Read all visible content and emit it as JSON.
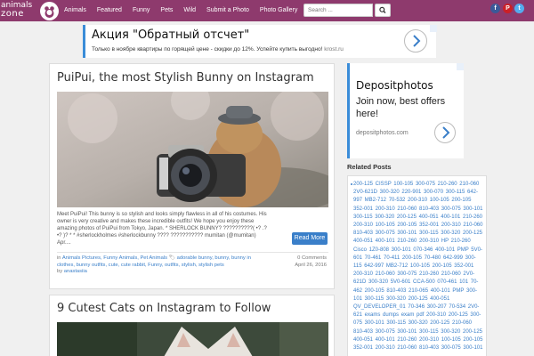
{
  "brand": {
    "logo_line1": "animals",
    "logo_line2": "zone"
  },
  "nav": {
    "links": [
      "Animals",
      "Featured",
      "Funny",
      "Pets",
      "Wild",
      "Submit a Photo",
      "Photo Gallery"
    ],
    "search_placeholder": "Search ...",
    "social": [
      "f",
      "P",
      "t"
    ]
  },
  "top_ad": {
    "title": "Акция \"Обратный отсчет\"",
    "subtitle": "Только в ноябре квартиры по горящей цене - скидки до 12%. Успейте купить выгодно!",
    "domain": "krost.ru"
  },
  "post1": {
    "title": "PuiPui, the most Stylish Bunny on Instagram",
    "excerpt": "Meet PuiPui! This bunny is so stylish and looks simply flawless in all of his costumes. His owner is very creative and makes these incredible outfits! We hope you enjoy these amazing photos of PuiPui from Tokyo, Japan. * SHERLOCK BUNNY? ??????????( •? .? •? )? * * #sherlockholmes #sherlockbunny ???? ??????????? mumitan (@mumitan) Apr....",
    "read_more": "Read More",
    "categories_prefix": "in",
    "categories": "Animals Pictures, Funny Animals, Pet Animals",
    "tags": "adorable bunny, bunny, bunny in clothes, bunny outfits, cute, cute rabbit, Funny, outfits, stylish, stylish pets",
    "author_prefix": "by",
    "author": "anastasiia",
    "comments": "0 Comments",
    "date": "April 26, 2016"
  },
  "post2": {
    "title": "9 Cutest Cats on Instagram to Follow"
  },
  "side_ad": {
    "title": "Depositphotos",
    "body": "Join now, best offers here!",
    "domain": "depositphotos.com"
  },
  "related": {
    "heading": "Related Posts",
    "text": "200-125 CISSP 100-105 300-075 210-260 210-060 2V0-621D 300-320 220-901 300-070 300-115 642-997 MB2-712 70-532 200-310 100-105 200-105 352-001 200-310 210-060 810-403 300-075 300-101 300-115 300-320 200-125 400-051 400-101 210-260 200-310 100-105 200-105 352-001 200-310 210-060 810-403 300-075 300-101 300-115 300-320 200-125 400-051 400-101 210-260 200-310 HP 210-260 Cisco 1Z0-808 300-101 070-346 400-101 PMP 5V0-601 70-461 70-411 200-105 70-480 642-999 300-115 642-997 MB2-712 100-105 200-105 352-001 200-310 210-060 300-075 210-260 210-060 2V0-621D 300-320 5V0-601 CCA-500 070-461 101 70-462 200-105 810-403 210-065 400-101 PMP 300-101 300-115 300-320 200-125 400-051 QV_DEVELOPER_01 70-346 300-207 70-534 2V0-621 exams dumps exam pdf 200-310 200-125 300-075 300-101 300-115 300-320 200-125 210-060 810-403 300-075 300-101 300-115 300-320 200-125 400-051 400-101 210-260 200-310 100-105 200-105 352-001 200-310 210-060 810-403 300-075 300-101"
  },
  "colors": {
    "navbar": "#8e3a6d",
    "link": "#3a7fc9",
    "button": "#3a7fc9"
  }
}
